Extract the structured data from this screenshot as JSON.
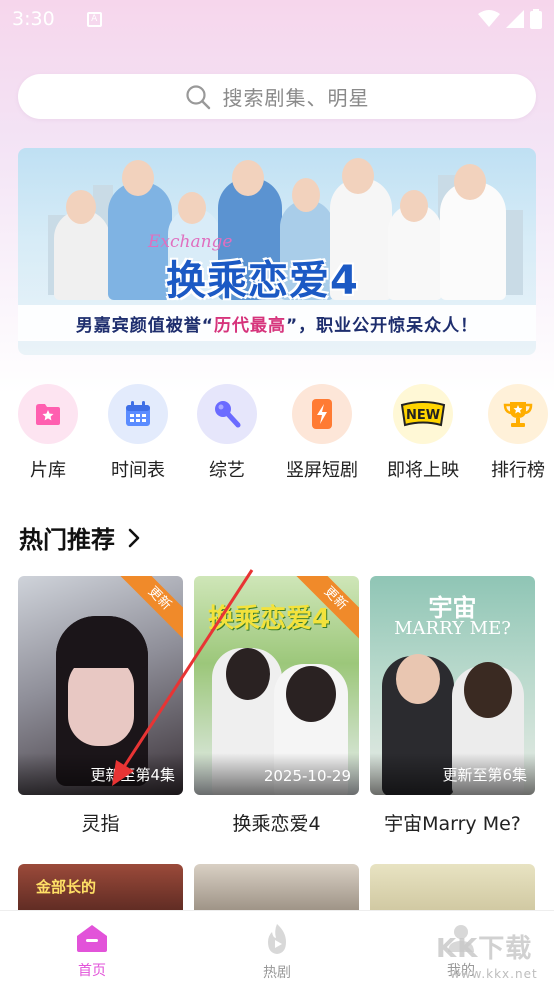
{
  "status_bar": {
    "time": "3:30",
    "notification_icon": "A"
  },
  "search": {
    "placeholder": "搜索剧集、明星",
    "icon": "search-icon"
  },
  "banner": {
    "script_text": "Exchange",
    "title": "换乘恋爱4",
    "strip_text_pre": "男嘉宾颜值被誉“",
    "strip_text_highlight": "历代最高",
    "strip_text_post": "”，职业公开惊呆众人！"
  },
  "categories": [
    {
      "label": "片库",
      "icon": "film-library-icon",
      "color": "#ff5fb0"
    },
    {
      "label": "时间表",
      "icon": "calendar-icon",
      "color": "#5b8cff"
    },
    {
      "label": "综艺",
      "icon": "microphone-icon",
      "color": "#6b6bff"
    },
    {
      "label": "竖屏短剧",
      "icon": "phone-lightning-icon",
      "color": "#ff7b33"
    },
    {
      "label": "即将上映",
      "icon": "new-badge-icon",
      "color": "#ffd400"
    },
    {
      "label": "排行榜",
      "icon": "trophy-icon",
      "color": "#ffae00"
    }
  ],
  "section": {
    "title": "热门推荐"
  },
  "cards": [
    {
      "title": "灵指",
      "caption": "更新至第4集",
      "ribbon": "更新"
    },
    {
      "title": "换乘恋爱4",
      "caption": "2025-10-29",
      "ribbon": "更新",
      "poster_title": "换乘恋爱4"
    },
    {
      "title": "宇宙Marry Me?",
      "caption": "更新至第6集",
      "poster_title_1": "宇宙",
      "poster_title_2": "MARRY ME?"
    }
  ],
  "second_row": [
    {
      "poster_text": "金部长的"
    }
  ],
  "tabbar": [
    {
      "label": "首页",
      "icon": "home-icon",
      "active": true
    },
    {
      "label": "热剧",
      "icon": "fire-icon",
      "active": false
    },
    {
      "label": "我的",
      "icon": "profile-icon",
      "active": false
    }
  ],
  "watermark": {
    "text": "KK下载",
    "sub": "www.kkx.net"
  },
  "colors": {
    "accent": "#e253d9",
    "ribbon": "#f08a2a",
    "banner_title": "#1b59c4"
  }
}
